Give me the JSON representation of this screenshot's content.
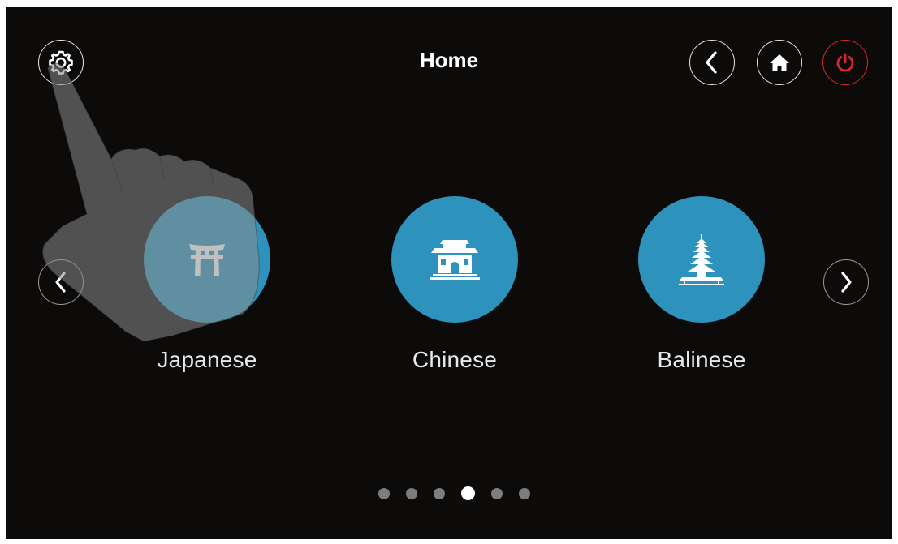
{
  "header": {
    "title": "Home",
    "settings_icon": "gear-icon",
    "back_icon": "chevron-left-icon",
    "home_icon": "home-icon",
    "power_icon": "power-icon"
  },
  "carousel": {
    "items": [
      {
        "label": "Japanese",
        "icon": "torii-gate-icon"
      },
      {
        "label": "Chinese",
        "icon": "chinese-temple-icon"
      },
      {
        "label": "Balinese",
        "icon": "balinese-pagoda-icon"
      }
    ],
    "prev_icon": "chevron-left-icon",
    "next_icon": "chevron-right-icon"
  },
  "pagination": {
    "total_pages": 6,
    "active_page": 4
  },
  "overlay": {
    "icon": "pointing-hand-icon"
  },
  "colors": {
    "background": "#0d0a0a",
    "accent": "#2e93bc",
    "power": "#d42a2a",
    "text": "#ffffff"
  }
}
